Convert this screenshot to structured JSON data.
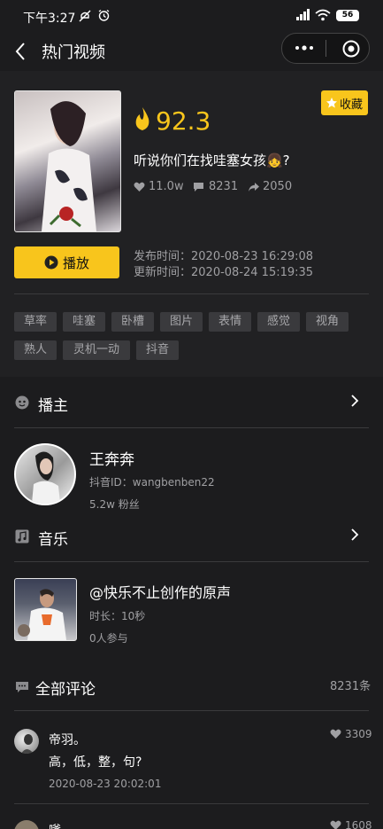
{
  "status": {
    "time": "下午3:27",
    "battery": "56"
  },
  "navbar": {
    "title": "热门视频"
  },
  "video": {
    "score": "92.3",
    "title": "听说你们在找哇塞女孩👧?",
    "likes": "11.0w",
    "comments": "8231",
    "shares": "2050",
    "favorite_label": "收藏",
    "play_label": "播放",
    "publish_time": "发布时间：2020-08-23 16:29:08",
    "update_time": "更新时间：2020-08-24 15:19:35",
    "tags": [
      "草率",
      "哇塞",
      "卧槽",
      "图片",
      "表情",
      "感觉",
      "视角",
      "熟人",
      "灵机一动",
      "抖音"
    ]
  },
  "anchor": {
    "section_title": "播主",
    "name": "王奔奔",
    "douyin_id": "抖音ID：wangbenben22",
    "fans": "5.2w 粉丝"
  },
  "music": {
    "section_title": "音乐",
    "name": "@快乐不止创作的原声",
    "duration": "时长：10秒",
    "participants": "0人参与"
  },
  "comments": {
    "section_title": "全部评论",
    "count": "8231条",
    "items": [
      {
        "user": "帝羽。",
        "likes": "3309",
        "text": "高，低，整，句?",
        "time": "2020-08-23 20:02:01"
      },
      {
        "user": "嗲",
        "likes": "1608"
      }
    ]
  },
  "colors": {
    "accent": "#f8c51c",
    "background": "#1c1c1e",
    "hero_bg": "#212123"
  }
}
